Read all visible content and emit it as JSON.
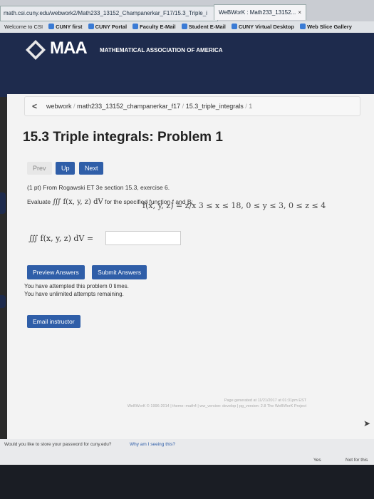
{
  "browser": {
    "url": "math.csi.cuny.edu/webwork2/Math233_13152_Champanerkar_F17/15.3_Triple_i",
    "tab_title": "WeBWorK : Math233_13152...",
    "tab_close": "×",
    "favorites": [
      "Welcome to CSI",
      "CUNY first",
      "CUNY Portal",
      "Faculty E-Mail",
      "Student E-Mail",
      "CUNY Virtual Desktop",
      "Web Slice Gallery"
    ]
  },
  "header": {
    "logo": "MAA",
    "subtitle": "MATHEMATICAL ASSOCIATION OF AMERICA"
  },
  "breadcrumb": {
    "back": "<",
    "items": [
      "webwork",
      "math233_13152_champanerkar_f17",
      "15.3_triple_integrals",
      "1"
    ]
  },
  "page": {
    "title": "15.3 Triple integrals: Problem 1",
    "buttons": {
      "prev": "Prev",
      "up": "Up",
      "next": "Next"
    }
  },
  "problem": {
    "points": "(1 pt) From Rogawski ET 3e section 15.3, exercise 6.",
    "prompt_start": "Evaluate",
    "prompt_integral": "∭ f(x, y, z) dV",
    "prompt_end": "for the specified function f and B:",
    "function": "f(x, y, z) = z/x   3 ≤ x ≤ 18, 0 ≤ y ≤ 3, 0 ≤ z ≤ 4",
    "answer_label": "∭ f(x, y, z) dV ="
  },
  "actions": {
    "preview": "Preview Answers",
    "submit": "Submit Answers",
    "attempts_1": "You have attempted this problem 0 times.",
    "attempts_2": "You have unlimited attempts remaining.",
    "email": "Email instructor"
  },
  "footer": {
    "line1": "Page generated at 11/21/2017 at 01:31pm EST",
    "line2": "WeBWorK © 1996-2014 | theme: math4 | ww_version: develop | pg_version: 2.8 The WeBWorK Project"
  },
  "password_bar": {
    "question": "Would you like to store your password for cuny.edu?",
    "why": "Why am I seeing this?",
    "yes": "Yes",
    "not_for": "Not for this"
  }
}
